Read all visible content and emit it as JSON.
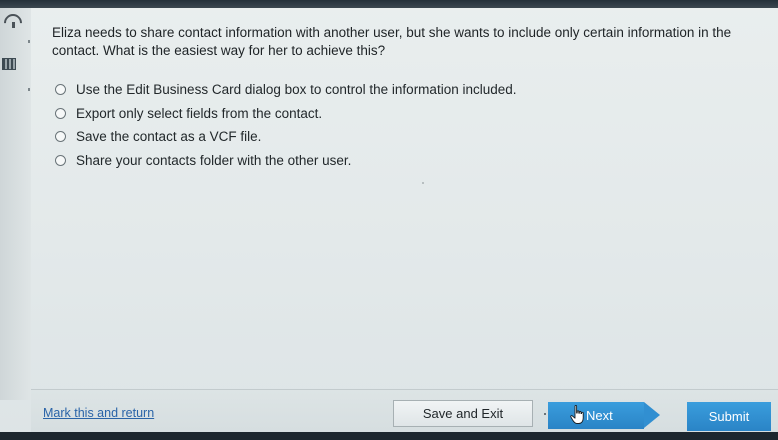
{
  "question": {
    "text": "Eliza needs to share contact information with another user, but she wants to include only certain information in the contact. What is the easiest way for her to achieve this?"
  },
  "choices": [
    {
      "label": "Use the Edit Business Card dialog box to control the information included."
    },
    {
      "label": "Export only select fields from the contact."
    },
    {
      "label": "Save the contact as a VCF file."
    },
    {
      "label": "Share your contacts folder with the other user."
    }
  ],
  "footer": {
    "mark_label": "Mark this and return",
    "save_exit_label": "Save and Exit",
    "next_label": "Next",
    "submit_label": "Submit"
  },
  "colors": {
    "link": "#2a64a8",
    "button_blue": "#2a84c6",
    "page_background": "#e3e9ea"
  },
  "icons": {
    "cursor": "hand-pointer-icon",
    "radio": "radio-unchecked-icon"
  }
}
